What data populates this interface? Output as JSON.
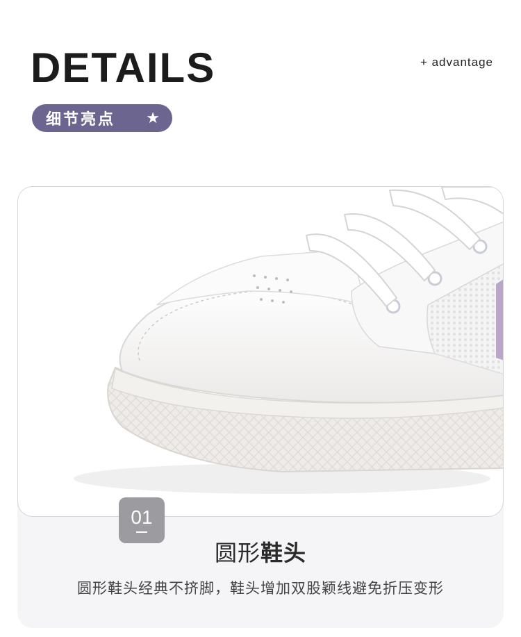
{
  "header": {
    "title": "DETAILS",
    "subtitle": "+ advantage",
    "badge_label": "细节亮点",
    "badge_icon": "star-icon"
  },
  "feature": {
    "number": "01",
    "heading_regular": "圆形",
    "heading_bold": "鞋头",
    "description": "圆形鞋头经典不挤脚，鞋头增加双股颖线避免折压变形"
  },
  "colors": {
    "badge": "#6b6590",
    "number_box": "#9c9ca0",
    "card": "#f5f4f7",
    "accent_purple": "#b9a6c9"
  }
}
